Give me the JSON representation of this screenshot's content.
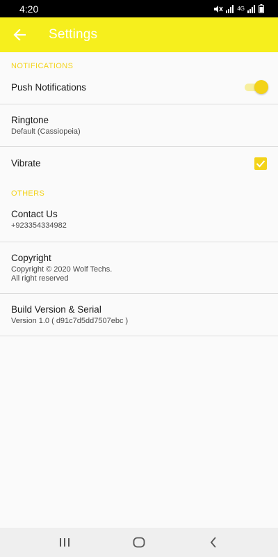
{
  "status_bar": {
    "time": "4:20",
    "network": "4G",
    "icons": [
      "mute-vibrate-icon",
      "signal-icon",
      "signal-icon",
      "battery-icon"
    ]
  },
  "app_bar": {
    "title": "Settings",
    "background": "#f6ef1d",
    "back_icon": "arrow-back-icon"
  },
  "sections": {
    "notifications": {
      "header": "NOTIFICATIONS",
      "push": {
        "title": "Push Notifications",
        "enabled": true
      },
      "ringtone": {
        "title": "Ringtone",
        "summary": "Default (Cassiopeia)"
      },
      "vibrate": {
        "title": "Vibrate",
        "checked": true
      }
    },
    "others": {
      "header": "OTHERS",
      "contact": {
        "title": "Contact Us",
        "summary": "+923354334982"
      },
      "copyright": {
        "title": "Copyright",
        "summary": "Copyright © 2020 Wolf Techs.\nAll right reserved"
      },
      "build": {
        "title": "Build Version & Serial",
        "summary": "Version 1.0 ( d91c7d5dd7507ebc )"
      }
    }
  },
  "colors": {
    "accent": "#f3d31a",
    "divider": "#dcdcdc"
  },
  "nav_bar": {
    "buttons": [
      "recents-icon",
      "home-icon",
      "back-icon"
    ]
  }
}
